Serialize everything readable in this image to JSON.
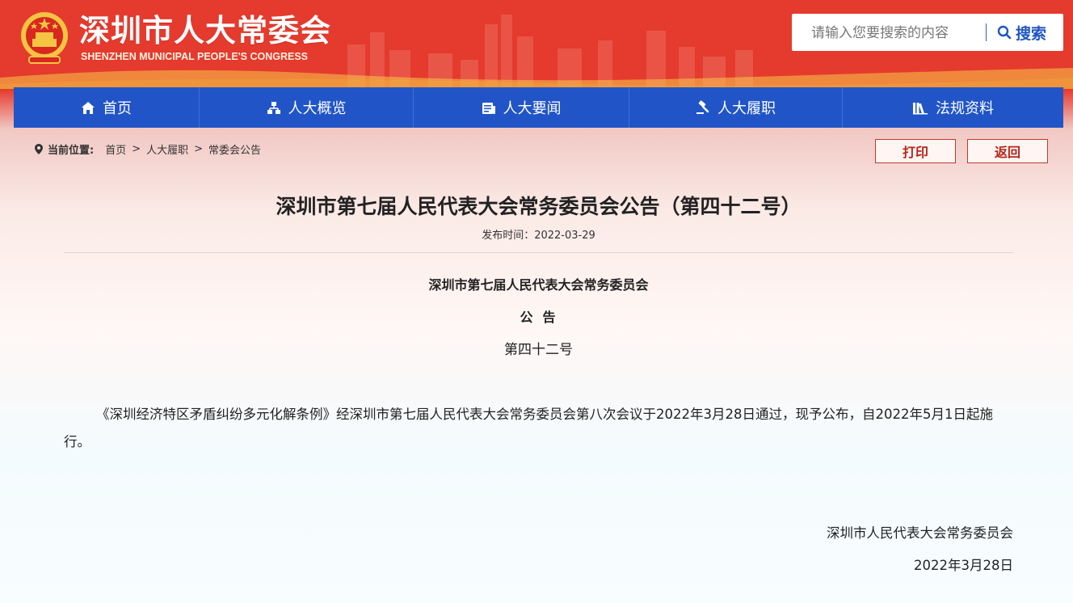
{
  "header": {
    "site_title": "深圳市人大常委会",
    "site_subtitle": "SHENZHEN MUNICIPAL PEOPLE'S CONGRESS",
    "search_placeholder": "请输入您要搜索的内容",
    "search_button": "搜索"
  },
  "nav": {
    "items": [
      {
        "label": "首页",
        "icon": "home-icon"
      },
      {
        "label": "人大概览",
        "icon": "sitemap-icon"
      },
      {
        "label": "人大要闻",
        "icon": "news-icon"
      },
      {
        "label": "人大履职",
        "icon": "gavel-icon"
      },
      {
        "label": "法规资料",
        "icon": "books-icon"
      }
    ]
  },
  "breadcrumb": {
    "label": "当前位置:",
    "items": [
      "首页",
      "人大履职",
      "常委会公告"
    ],
    "separator": ">"
  },
  "actions": {
    "print": "打印",
    "back": "返回"
  },
  "article": {
    "title": "深圳市第七届人民代表大会常务委员会公告（第四十二号）",
    "publish_time": "发布时间：2022-03-29",
    "org_line": "深圳市第七届人民代表大会常务委员会",
    "notice_word": "公告",
    "number_line": "第四十二号",
    "body": "《深圳经济特区矛盾纠纷多元化解条例》经深圳市第七届人民代表大会常务委员会第八次会议于2022年3月28日通过，现予公布，自2022年5月1日起施行。",
    "signature_org": "深圳市人民代表大会常务委员会",
    "signature_date": "2022年3月28日"
  },
  "colors": {
    "header_red": "#e53a2e",
    "nav_blue": "#2155c7",
    "button_red": "#b5251a"
  }
}
